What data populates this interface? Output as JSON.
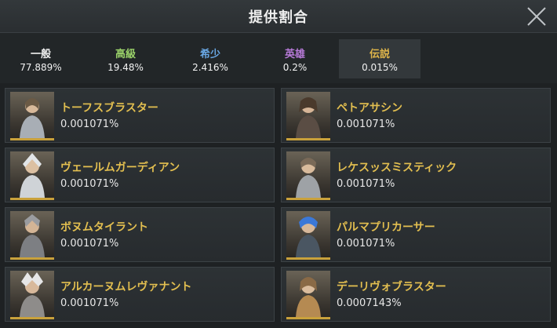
{
  "header": {
    "title": "提供割合"
  },
  "tabs": [
    {
      "label": "一般",
      "rate": "77.889%",
      "color": "#f2f2f2"
    },
    {
      "label": "高級",
      "rate": "19.48%",
      "color": "#9bd36a"
    },
    {
      "label": "希少",
      "rate": "2.416%",
      "color": "#6aa9e6"
    },
    {
      "label": "英雄",
      "rate": "0.2%",
      "color": "#b77ad8"
    },
    {
      "label": "伝説",
      "rate": "0.015%",
      "color": "#e0b64a"
    }
  ],
  "active_tab": "伝説",
  "items": [
    {
      "name": "トーフスブラスター",
      "rate": "0.001071%",
      "portrait_color": "#a8aeb5"
    },
    {
      "name": "ペトアサシン",
      "rate": "0.001071%",
      "portrait_color": "#5a4d44"
    },
    {
      "name": "ヴェールムガーディアン",
      "rate": "0.001071%",
      "portrait_color": "#cfd3d7"
    },
    {
      "name": "レケスッスミスティック",
      "rate": "0.001071%",
      "portrait_color": "#9ea2a6"
    },
    {
      "name": "ボヌムタイラント",
      "rate": "0.001071%",
      "portrait_color": "#7d7f83"
    },
    {
      "name": "パルマプリカーサー",
      "rate": "0.001071%",
      "portrait_color": "#3b78d8"
    },
    {
      "name": "アルカーヌムレヴァナント",
      "rate": "0.001071%",
      "portrait_color": "#8e8c8a"
    },
    {
      "name": "デーリヴォブラスター",
      "rate": "0.0007143%",
      "portrait_color": "#b58a52"
    }
  ]
}
